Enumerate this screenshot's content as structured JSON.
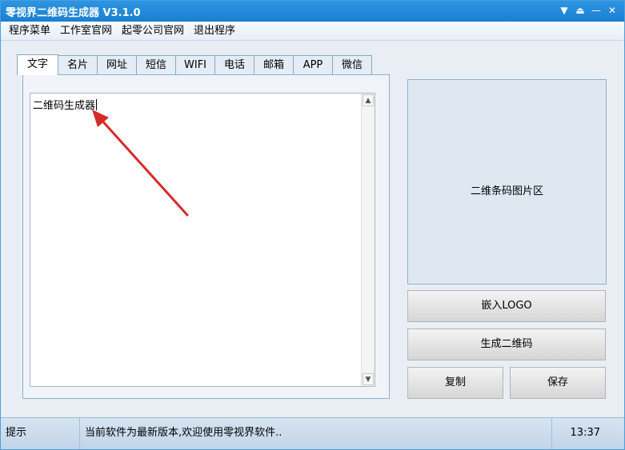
{
  "window": {
    "title": "零视界二维码生成器 V3.1.0",
    "controls": [
      "▼",
      "⏏",
      "—",
      "✕"
    ]
  },
  "menu": {
    "items": [
      "程序菜单",
      "工作室官网",
      "起零公司官网",
      "退出程序"
    ]
  },
  "tabs": [
    "文字",
    "名片",
    "网址",
    "短信",
    "WIFI",
    "电话",
    "邮箱",
    "APP",
    "微信"
  ],
  "active_tab": "文字",
  "editor": {
    "text": "二维码生成器"
  },
  "qr_area": {
    "label": "二维条码图片区"
  },
  "buttons": {
    "embed_logo": "嵌入LOGO",
    "generate": "生成二维码",
    "copy": "复制",
    "save": "保存"
  },
  "status": {
    "label": "提示",
    "message": "当前软件为最新版本,欢迎使用零视界软件..",
    "time": "13:37"
  },
  "colors": {
    "titlebar": "#1f88d8",
    "arrow": "#d62a2a"
  }
}
